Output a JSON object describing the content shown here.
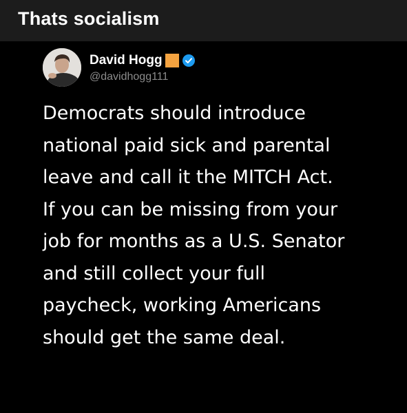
{
  "post": {
    "title": "Thats socialism"
  },
  "tweet": {
    "author": {
      "display_name": "David Hogg",
      "handle": "@davidhogg111",
      "badges": [
        "orange-square-emoji",
        "verified-badge-icon"
      ],
      "colors": {
        "flag": "#f4a340",
        "verified": "#1d9bf0"
      }
    },
    "text_lines": [
      "Democrats should introduce",
      "national paid sick and parental",
      "leave and call it the MITCH Act.",
      "If you can be missing from your",
      "job for months as a U.S. Senator",
      "and still collect your full",
      "paycheck, working Americans",
      "should get the same deal."
    ]
  }
}
